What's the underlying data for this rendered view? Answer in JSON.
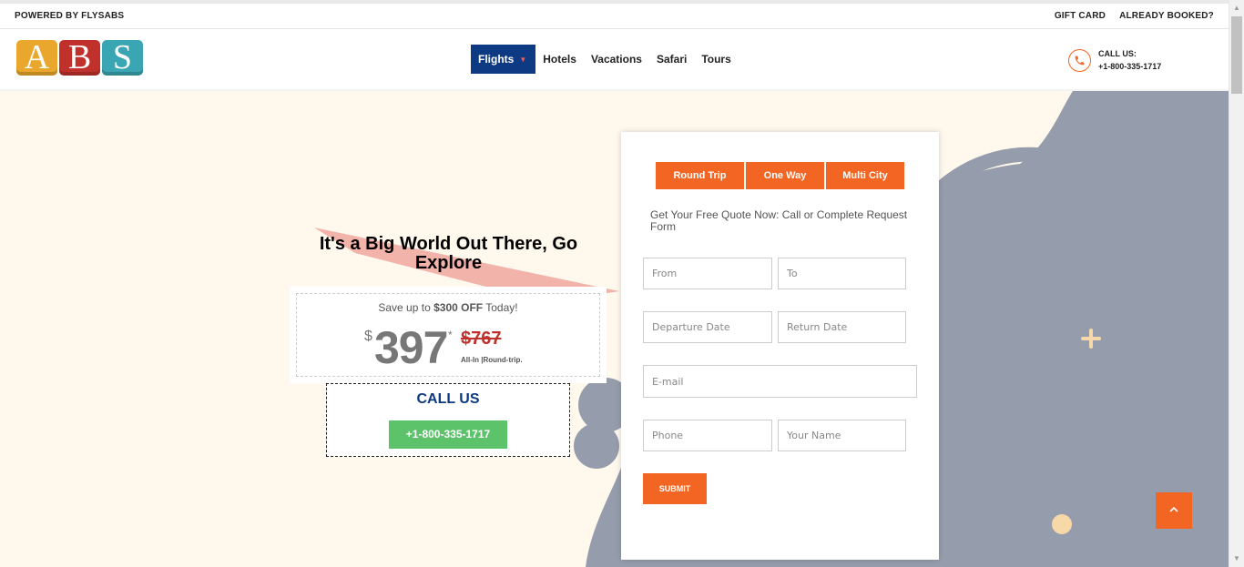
{
  "topbar": {
    "powered_by": "POWERED BY FLYSABS",
    "gift_card": "GIFT CARD",
    "already_booked": "ALREADY BOOKED?"
  },
  "logo": {
    "letters": [
      "A",
      "B",
      "S"
    ]
  },
  "nav": {
    "items": [
      {
        "label": "Flights",
        "active": true
      },
      {
        "label": "Hotels"
      },
      {
        "label": "Vacations"
      },
      {
        "label": "Safari"
      },
      {
        "label": "Tours"
      }
    ]
  },
  "header_call": {
    "label": "CALL US:",
    "number": "+1-800-335-1717"
  },
  "hero": {
    "headline": "It's a Big World Out There, Go Explore",
    "deal": {
      "save_prefix": "Save up to ",
      "save_amount": "$300 OFF",
      "save_suffix": " Today!",
      "currency": "$",
      "price": "397",
      "asterisk": "*",
      "old_price": "$767",
      "note": "All-In |Round-trip."
    },
    "call_box": {
      "title": "CALL US",
      "number": "+1-800-335-1717"
    }
  },
  "form": {
    "tabs": [
      "Round Trip",
      "One Way",
      "Multi City"
    ],
    "hint": "Get Your Free Quote Now: Call or Complete Request Form",
    "placeholders": {
      "from": "From",
      "to": "To",
      "departure": "Departure Date",
      "return": "Return Date",
      "email": "E-mail",
      "phone": "Phone",
      "name": "Your Name"
    },
    "submit": "SUBMIT"
  },
  "colors": {
    "accent": "#f26522",
    "nav_active": "#0d3a82",
    "call_green": "#5cc36a",
    "hero_bg": "#fff8ec",
    "shape_grey": "#959dac",
    "old_price": "#c1312c"
  },
  "icons": {
    "phone": "phone-icon",
    "caret": "caret-down-icon",
    "back_to_top": "chevron-up-icon"
  }
}
